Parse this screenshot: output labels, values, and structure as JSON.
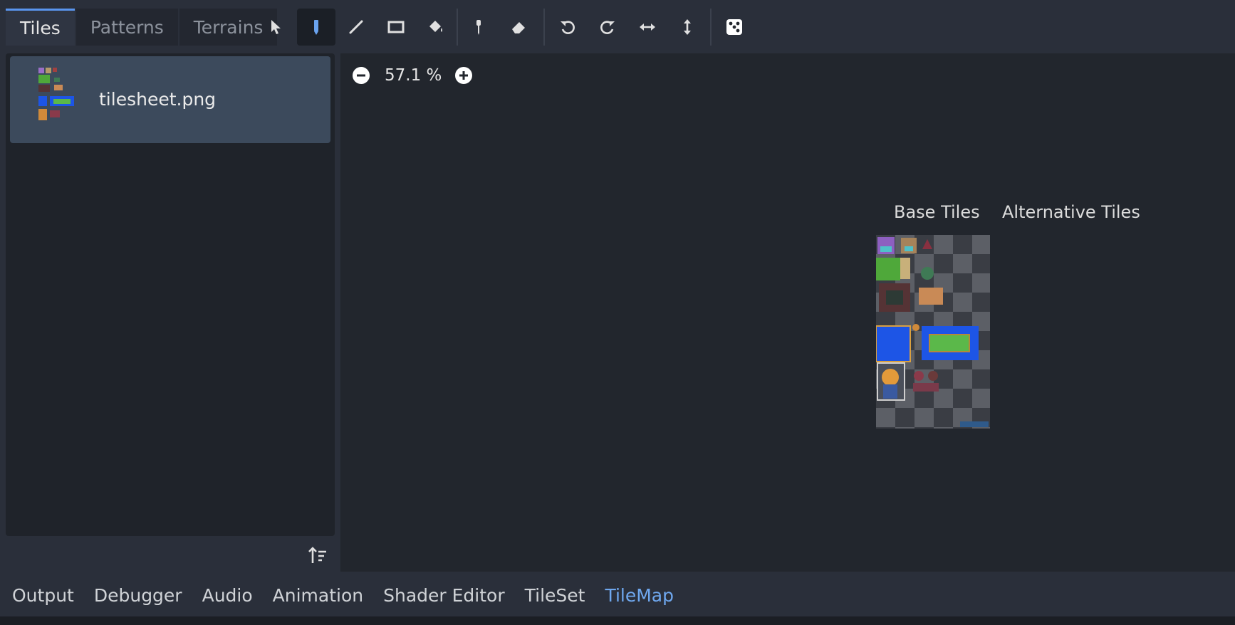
{
  "tabs": [
    "Tiles",
    "Patterns",
    "Terrains"
  ],
  "tools": [
    {
      "icon": "select-arrow-icon"
    },
    {
      "icon": "paint-pencil-icon",
      "active": true
    },
    {
      "icon": "line-icon"
    },
    {
      "icon": "rectangle-icon"
    },
    {
      "icon": "bucket-fill-icon"
    },
    {
      "icon": "eyedropper-icon"
    },
    {
      "icon": "eraser-icon"
    },
    {
      "icon": "rotate-left-icon"
    },
    {
      "icon": "rotate-right-icon"
    },
    {
      "icon": "flip-horizontal-icon"
    },
    {
      "icon": "flip-vertical-icon"
    },
    {
      "icon": "random-dice-icon"
    }
  ],
  "sources": [
    {
      "name": "tilesheet.png"
    }
  ],
  "viewport": {
    "zoom": "57.1 %",
    "base_tiles_label": "Base Tiles",
    "alternative_tiles_label": "Alternative Tiles"
  },
  "bottom_tabs": [
    "Output",
    "Debugger",
    "Audio",
    "Animation",
    "Shader Editor",
    "TileSet",
    "TileMap"
  ],
  "active_bottom_tab": "TileMap",
  "colors": {
    "accent": "#5a95ee",
    "active_tab_text": "#6fa8ef",
    "selected_item": "#3c4a5c",
    "viewport_bg": "#22262d"
  }
}
